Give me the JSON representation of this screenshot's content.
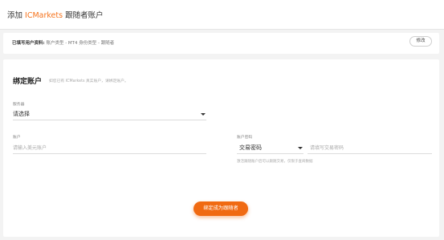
{
  "header": {
    "title_prefix": "添加 ",
    "title_brand": "ICMarkets",
    "title_suffix": " 跟随者账户"
  },
  "info": {
    "label": "已填写用户资料:",
    "value": " 账户类型 - MT4 身份类型 - 跟随者",
    "edit_label": "修改"
  },
  "bind_section": {
    "title": "绑定账户",
    "hint": "如您已有 ICMarkets 真实账户，请绑定账户。",
    "server_label": "服务器",
    "server_value": "请选择",
    "account_label": "账户",
    "account_placeholder": "请输入美元账户",
    "password_label": "账户密码",
    "password_type_value": "交易密码",
    "password_placeholder": "请填写交易密码",
    "password_help": "激活跟随账户后可以跟随交易，仅限于查阅数据",
    "submit_label": "绑定成为跟随者"
  },
  "colors": {
    "accent": "#f06a12",
    "brand": "#f5721b",
    "background": "#f3f3f3"
  }
}
